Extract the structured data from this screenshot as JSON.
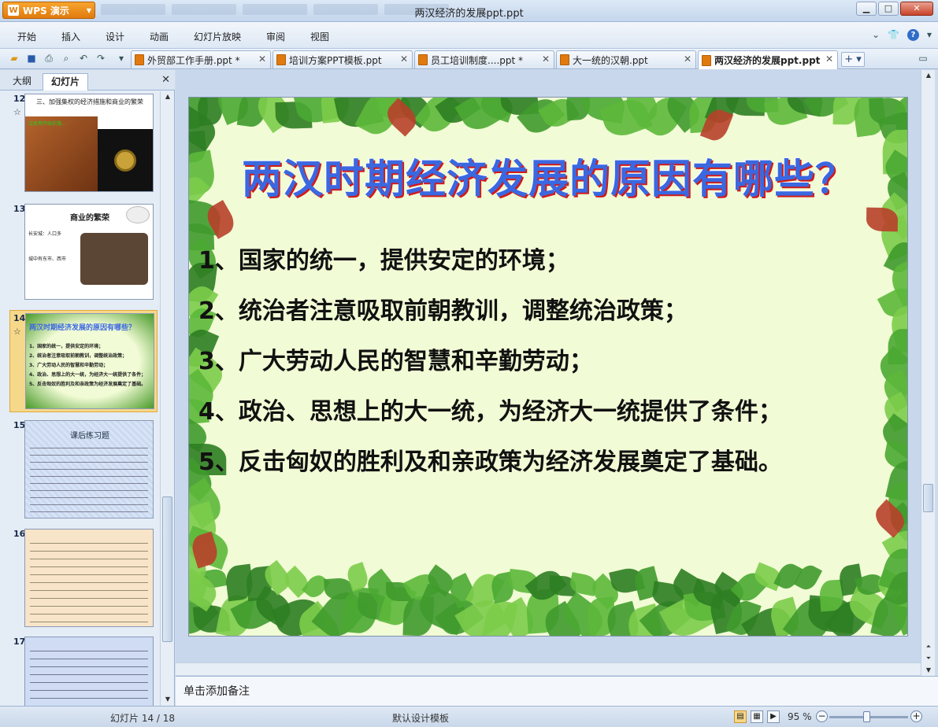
{
  "app": {
    "button_label": "WPS 演示",
    "window_title": "两汉经济的发展ppt.ppt"
  },
  "menu": [
    "开始",
    "插入",
    "设计",
    "动画",
    "幻灯片放映",
    "审阅",
    "视图"
  ],
  "tabs": [
    {
      "label": "外贸部工作手册.ppt *"
    },
    {
      "label": "培训方案PPT模板.ppt"
    },
    {
      "label": "员工培训制度....ppt *"
    },
    {
      "label": "大一统的汉朝.ppt"
    },
    {
      "label": "两汉经济的发展ppt.ppt",
      "active": true
    }
  ],
  "left_pane": {
    "tab_outline": "大纲",
    "tab_slides": "幻灯片",
    "thumbnails": [
      {
        "number": "12",
        "title": "三、加强集权的经济措施和商业的繁荣",
        "text": "汉武帝开始实施…"
      },
      {
        "number": "13",
        "title": "商业的繁荣",
        "bullets": [
          "长安城：人口多",
          "城中有东市、西市"
        ]
      },
      {
        "number": "14",
        "title": "两汉时期经济发展的原因有哪些？"
      },
      {
        "number": "15",
        "title": "课后练习题"
      },
      {
        "number": "16"
      },
      {
        "number": "17"
      }
    ]
  },
  "slide": {
    "title": "两汉时期经济发展的原因有哪些？",
    "lines": [
      "1、国家的统一，提供安定的环境；",
      "2、统治者注意吸取前朝教训，调整统治政策；",
      "3、广大劳动人民的智慧和辛勤劳动；",
      "4、政治、思想上的大一统，为经济大一统提供了条件；",
      "5、反击匈奴的胜利及和亲政策为经济发展奠定了基础。"
    ]
  },
  "notes_placeholder": "单击添加备注",
  "status": {
    "slide_info": "幻灯片 14 / 18",
    "template": "默认设计模板",
    "zoom": "95 %"
  },
  "colors": {
    "accent": "#e07a0e",
    "slide_title": "#3a68e0",
    "slide_bg": "#f1fbd5"
  }
}
